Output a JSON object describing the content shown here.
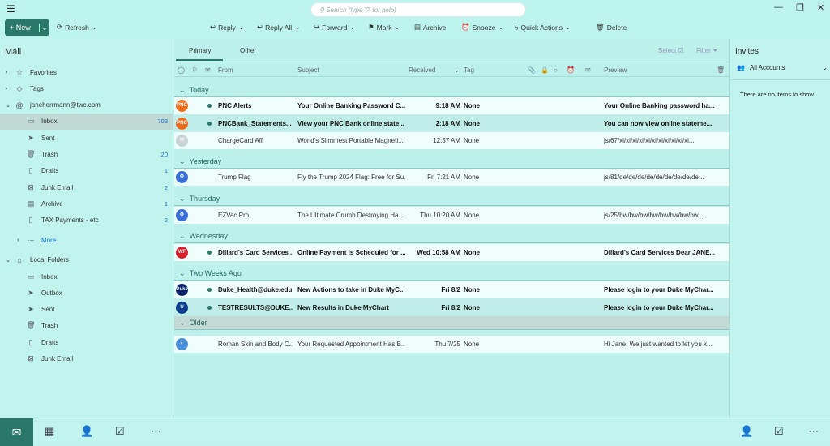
{
  "search": {
    "placeholder": "Search (type '?' for help)"
  },
  "toolbar": {
    "new": "New",
    "refresh": "Refresh",
    "reply": "Reply",
    "reply_all": "Reply All",
    "forward": "Forward",
    "mark": "Mark",
    "archive": "Archive",
    "snooze": "Snooze",
    "quick_actions": "Quick Actions",
    "delete": "Delete"
  },
  "sidebar": {
    "title": "Mail",
    "items": [
      {
        "label": "Favorites",
        "icon": "star",
        "level": 0,
        "chev": "›"
      },
      {
        "label": "Tags",
        "icon": "tag",
        "level": 0,
        "chev": "›"
      },
      {
        "label": "janeherrmann@twc.com",
        "icon": "at",
        "level": 0,
        "chev": "⌄"
      },
      {
        "label": "Inbox",
        "icon": "inbox",
        "level": 1,
        "count": "703",
        "selected": true
      },
      {
        "label": "Sent",
        "icon": "send",
        "level": 1
      },
      {
        "label": "Trash",
        "icon": "trash",
        "level": 1,
        "count": "20"
      },
      {
        "label": "Drafts",
        "icon": "draft",
        "level": 1,
        "count": "1"
      },
      {
        "label": "Junk Email",
        "icon": "junk",
        "level": 1,
        "count": "2"
      },
      {
        "label": "Archive",
        "icon": "archive",
        "level": 1,
        "count": "1"
      },
      {
        "label": "TAX Payments - etc",
        "icon": "folder",
        "level": 1,
        "count": "2"
      },
      {
        "label": "More",
        "icon": "more",
        "level": 1,
        "chev": "›",
        "link": true
      },
      {
        "label": "Local Folders",
        "icon": "home",
        "level": 0,
        "chev": "⌄"
      },
      {
        "label": "Inbox",
        "icon": "inbox",
        "level": 1
      },
      {
        "label": "Outbox",
        "icon": "send",
        "level": 1
      },
      {
        "label": "Sent",
        "icon": "send",
        "level": 1
      },
      {
        "label": "Trash",
        "icon": "trash",
        "level": 1
      },
      {
        "label": "Drafts",
        "icon": "draft",
        "level": 1
      },
      {
        "label": "Junk Email",
        "icon": "junk",
        "level": 1
      }
    ]
  },
  "list": {
    "tabs": [
      "Primary",
      "Other"
    ],
    "select": "Select",
    "filter": "Filter",
    "columns": {
      "from": "From",
      "subject": "Subject",
      "received": "Received",
      "tag": "Tag",
      "preview": "Preview"
    },
    "groups": [
      {
        "name": "Today",
        "rows": [
          {
            "from": "PNC Alerts",
            "subject": "Your Online Banking Password C...",
            "received": "9:18 AM",
            "tag": "None",
            "preview": "Your Online Banking password ha...",
            "unread": true,
            "avatar": "PNC",
            "color": "#f26b1d"
          },
          {
            "from": "PNCBank_Statements...",
            "subject": "View your PNC Bank online state...",
            "received": "2:18 AM",
            "tag": "None",
            "preview": "You can now view online stateme...",
            "unread": true,
            "avatar": "PNC",
            "color": "#f26b1d"
          },
          {
            "from": "ChargeCard Aff",
            "subject": "World's Slimmest Portable Magneti...",
            "received": "12:57 AM",
            "tag": "None",
            "preview": "js/67/xl/xl/xl/xl/xl/xl/xl/xl/xl/xl/xl...",
            "unread": false,
            "avatar": "✉",
            "color": "#c9d4d6"
          }
        ]
      },
      {
        "name": "Yesterday",
        "rows": [
          {
            "from": "Trump Flag",
            "subject": "Fly the Trump 2024 Flag: Free for Su...",
            "received": "Fri 7:21 AM",
            "tag": "None",
            "preview": "js/81/de/de/de/de/de/de/de/de/de...",
            "unread": false,
            "avatar": "⚙",
            "color": "#3b6fd8"
          }
        ]
      },
      {
        "name": "Thursday",
        "rows": [
          {
            "from": "EZVac Pro",
            "subject": "The Ultimate Crumb Destroying Ha...",
            "received": "Thu 10:20 AM",
            "tag": "None",
            "preview": "js/25/bw/bw/bw/bw/bw/bw/bw/bw...",
            "unread": false,
            "avatar": "⚙",
            "color": "#3b6fd8"
          }
        ]
      },
      {
        "name": "Wednesday",
        "rows": [
          {
            "from": "Dillard's Card Services ...",
            "subject": "Online Payment is Scheduled for ...",
            "received": "Wed 10:58 AM",
            "tag": "None",
            "preview": "Dillard's Card Services Dear JANE...",
            "unread": true,
            "avatar": "WF",
            "color": "#d71e28"
          }
        ]
      },
      {
        "name": "Two Weeks Ago",
        "rows": [
          {
            "from": "Duke_Health@duke.edu",
            "subject": "New Actions to take in Duke MyC...",
            "received": "Fri 8/2",
            "tag": "None",
            "preview": "Please login to your Duke MyChar...",
            "unread": true,
            "avatar": "Duke",
            "color": "#012169"
          },
          {
            "from": "TESTRESULTS@DUKE...",
            "subject": "New Results in Duke MyChart",
            "received": "Fri 8/2",
            "tag": "None",
            "preview": "Please login to your Duke MyChar...",
            "unread": true,
            "avatar": "U",
            "color": "#0a3d8f"
          }
        ]
      },
      {
        "name": "Older",
        "gray": true,
        "rows": [
          {
            "from": "Roman Skin and Body C...",
            "subject": "Your Requested Appointment Has B...",
            "received": "Thu 7/25",
            "tag": "None",
            "preview": "Hi Jane,  We just wanted to let you k...",
            "unread": false,
            "avatar": "◐",
            "color": "#4a90d9"
          }
        ]
      }
    ]
  },
  "invites": {
    "title": "Invites",
    "accounts": "All Accounts",
    "empty": "There are no items to show."
  }
}
